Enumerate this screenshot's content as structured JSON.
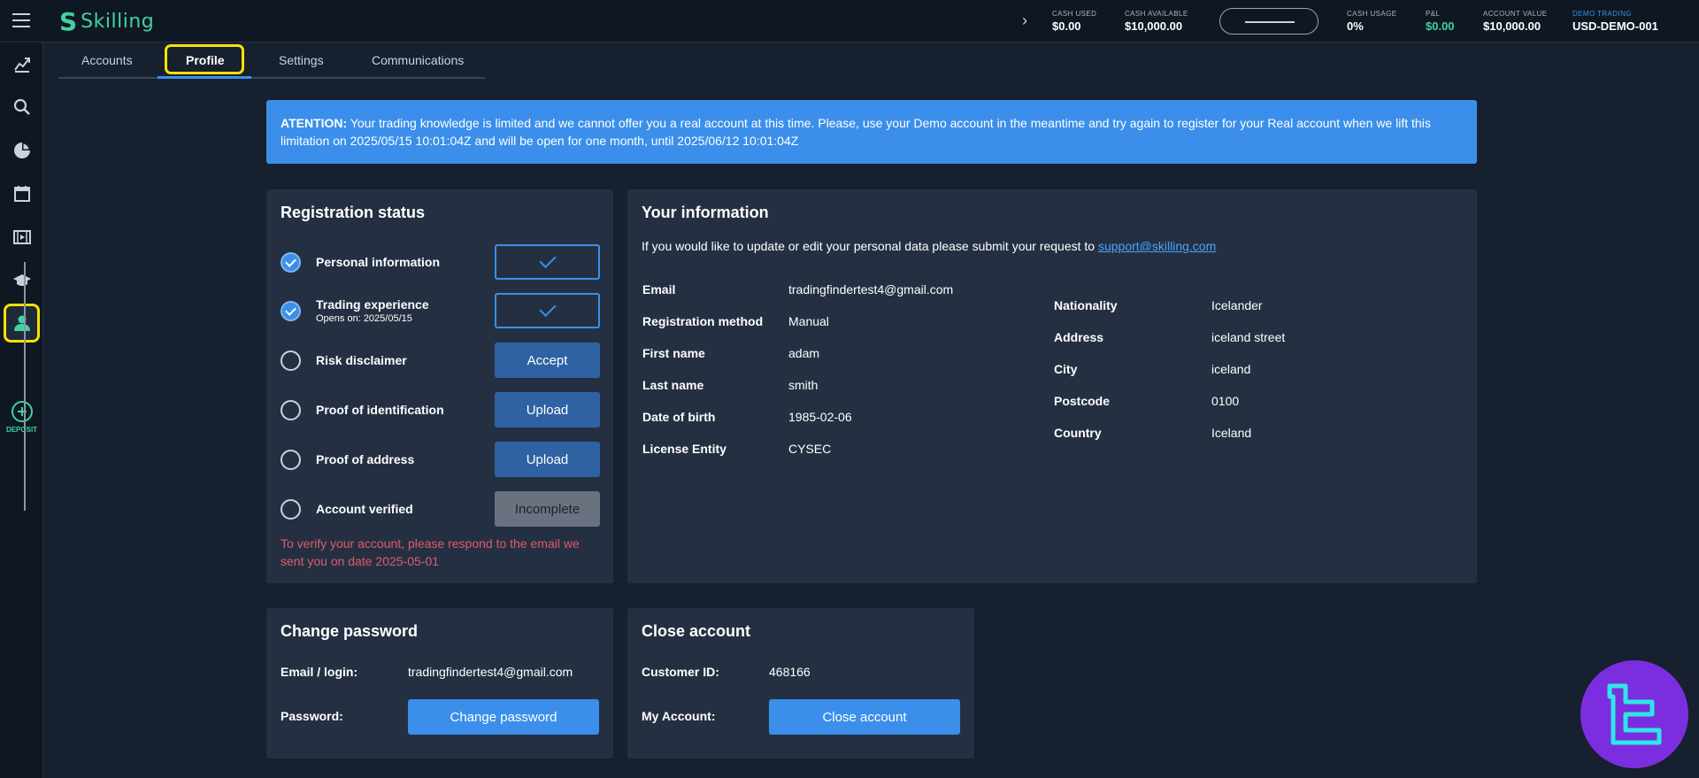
{
  "header": {
    "brand": "Skilling",
    "stats": [
      {
        "label": "CASH USED",
        "value": "$0.00"
      },
      {
        "label": "CASH AVAILABLE",
        "value": "$10,000.00"
      },
      {
        "label": "CASH USAGE",
        "value": "0%"
      },
      {
        "label": "P&L",
        "value": "$0.00"
      },
      {
        "label": "ACCOUNT VALUE",
        "value": "$10,000.00"
      },
      {
        "label": "DEMO TRADING",
        "value": "USD-DEMO-001"
      }
    ],
    "pnl_color": "#3fd3a0",
    "demo_label_color": "#3b8fea"
  },
  "sidebar": {
    "items": [
      "chart-icon",
      "search-icon",
      "pie-chart-icon",
      "calendar-icon",
      "video-icon",
      "graduation-cap-icon",
      "user-icon"
    ],
    "deposit_label": "DEPOSIT"
  },
  "tabs": [
    {
      "label": "Accounts"
    },
    {
      "label": "Profile",
      "active": true
    },
    {
      "label": "Settings"
    },
    {
      "label": "Communications"
    }
  ],
  "alert": {
    "prefix": "ATENTION:",
    "text": " Your trading knowledge is limited and we cannot offer you a real account at this time. Please, use your Demo account in the meantime and try again to register for your Real account when we lift this limitation on 2025/05/15 10:01:04Z and will be open for one month, until 2025/06/12 10:01:04Z"
  },
  "registration": {
    "title": "Registration status",
    "steps": [
      {
        "name": "Personal information",
        "sub": "",
        "done": true,
        "button": ""
      },
      {
        "name": "Trading experience",
        "sub": "Opens on: 2025/05/15",
        "done": true,
        "button": ""
      },
      {
        "name": "Risk disclaimer",
        "sub": "",
        "done": false,
        "button": "Accept"
      },
      {
        "name": "Proof of identification",
        "sub": "",
        "done": false,
        "button": "Upload"
      },
      {
        "name": "Proof of address",
        "sub": "",
        "done": false,
        "button": "Upload"
      },
      {
        "name": "Account verified",
        "sub": "",
        "done": false,
        "button": "Incomplete"
      }
    ],
    "verify_msg": "To verify your account, please respond to the email we sent you on date 2025-05-01"
  },
  "info": {
    "title": "Your information",
    "intro": "If you would like to update or edit your personal data please submit your request to ",
    "support_link": "support@skilling.com",
    "left": [
      {
        "key": "Email",
        "value": "tradingfindertest4@gmail.com"
      },
      {
        "key": "Registration method",
        "value": "Manual"
      },
      {
        "key": "First name",
        "value": "adam"
      },
      {
        "key": "Last name",
        "value": "smith"
      },
      {
        "key": "Date of birth",
        "value": "1985-02-06"
      },
      {
        "key": "License Entity",
        "value": "CYSEC"
      }
    ],
    "right": [
      {
        "key": "Nationality",
        "value": "Icelander"
      },
      {
        "key": "Address",
        "value": "iceland street"
      },
      {
        "key": "City",
        "value": "iceland"
      },
      {
        "key": "Postcode",
        "value": "0100"
      },
      {
        "key": "Country",
        "value": "Iceland"
      }
    ]
  },
  "password": {
    "title": "Change password",
    "email_key": "Email / login:",
    "email_value": "tradingfindertest4@gmail.com",
    "password_key": "Password:",
    "button": "Change password"
  },
  "close": {
    "title": "Close account",
    "customer_key": "Customer ID:",
    "customer_value": "468166",
    "account_key": "My Account:",
    "button": "Close account"
  },
  "accent_color": "#3b8fea",
  "highlight_color": "#f5e300"
}
